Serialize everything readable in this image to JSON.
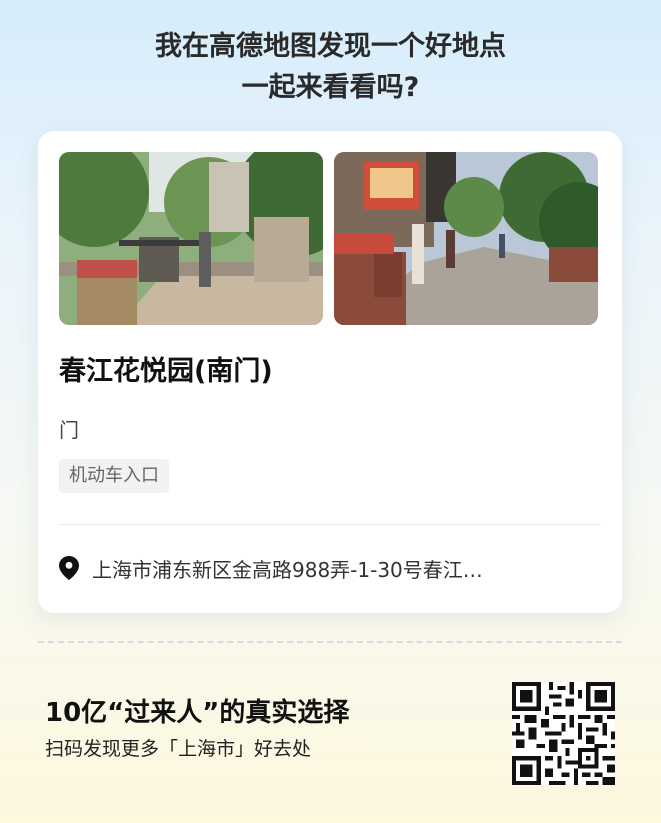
{
  "header": {
    "line1": "我在高德地图发现一个好地点",
    "line2": "一起来看看吗?"
  },
  "place": {
    "name": "春江花悦园(南门)",
    "category": "门",
    "tag": "机动车入口",
    "address": "上海市浦东新区金高路988弄-1-30号春江…"
  },
  "footer": {
    "title": "10亿“过来人”的真实选择",
    "subtitle": "扫码发现更多「上海市」好去处"
  },
  "colors": {
    "page_top": "#d6ecfb",
    "page_bottom": "#fdf8de",
    "card": "#ffffff",
    "tag_bg": "#f2f2f2"
  }
}
